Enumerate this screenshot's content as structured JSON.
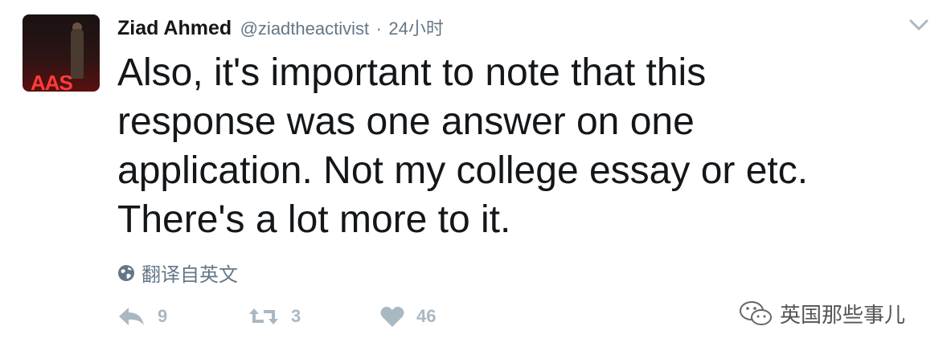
{
  "author": {
    "name": "Ziad Ahmed",
    "handle": "@ziadtheactivist",
    "separator": "·",
    "time": "24小时",
    "avatar_text": "AAS"
  },
  "tweet": {
    "text": "Also, it's important to note that this\nresponse was one answer on one\napplication. Not my college essay or etc.\nThere's a lot more to it."
  },
  "translate": {
    "label": "翻译自英文",
    "icon": "globe-icon"
  },
  "actions": {
    "reply_count": "9",
    "retweet_count": "3",
    "like_count": "46"
  },
  "watermark": {
    "text": "英国那些事儿",
    "icon": "wechat-icon"
  },
  "colors": {
    "text": "#14171a",
    "muted": "#657786",
    "action": "#aab8c2"
  }
}
